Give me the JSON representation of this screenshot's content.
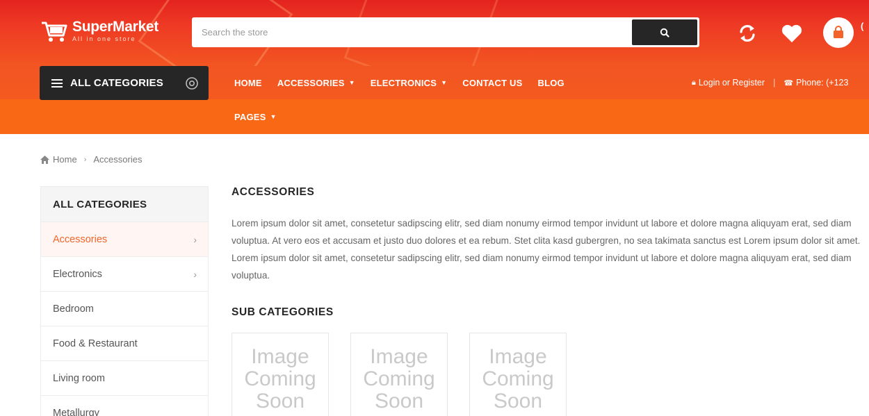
{
  "brand": {
    "name": "SuperMarket",
    "tagline": "All in one store"
  },
  "search": {
    "placeholder": "Search the store"
  },
  "header_icons": [
    "refresh-icon",
    "heart-icon",
    "shopping-bag-icon"
  ],
  "nav": {
    "all_categories": "ALL CATEGORIES",
    "menu": [
      {
        "label": "HOME",
        "has_dropdown": false
      },
      {
        "label": "ACCESSORIES",
        "has_dropdown": true
      },
      {
        "label": "ELECTRONICS",
        "has_dropdown": true
      },
      {
        "label": "CONTACT US",
        "has_dropdown": false
      },
      {
        "label": "BLOG",
        "has_dropdown": false
      }
    ],
    "menu_row2": [
      {
        "label": "PAGES",
        "has_dropdown": true
      }
    ],
    "login": "Login or Register",
    "phone": "Phone: (+123"
  },
  "breadcrumb": {
    "home": "Home",
    "current": "Accessories"
  },
  "sidebar": {
    "title": "ALL CATEGORIES",
    "items": [
      {
        "label": "Accessories",
        "active": true,
        "has_children": true
      },
      {
        "label": "Electronics",
        "active": false,
        "has_children": true
      },
      {
        "label": "Bedroom",
        "active": false,
        "has_children": false
      },
      {
        "label": "Food & Restaurant",
        "active": false,
        "has_children": false
      },
      {
        "label": "Living room",
        "active": false,
        "has_children": false
      },
      {
        "label": "Metallurgy",
        "active": false,
        "has_children": false
      }
    ]
  },
  "main": {
    "title": "ACCESSORIES",
    "description": "Lorem ipsum dolor sit amet, consetetur sadipscing elitr, sed diam nonumy eirmod tempor invidunt ut labore et dolore magna aliquyam erat, sed diam voluptua. At vero eos et accusam et justo duo dolores et ea rebum. Stet clita kasd gubergren, no sea takimata sanctus est Lorem ipsum dolor sit amet. Lorem ipsum dolor sit amet, consetetur sadipscing elitr, sed diam nonumy eirmod tempor invidunt ut labore et dolore magna aliquyam erat, sed diam voluptua.",
    "subcategories_title": "SUB CATEGORIES",
    "subcategories": [
      {
        "placeholder": "Image Coming Soon"
      },
      {
        "placeholder": "Image Coming Soon"
      },
      {
        "placeholder": "Image Coming Soon"
      }
    ]
  },
  "colors": {
    "header_red": "#e4231f",
    "nav_orange": "#f96815",
    "dark": "#262626",
    "accent": "#f2642a"
  }
}
